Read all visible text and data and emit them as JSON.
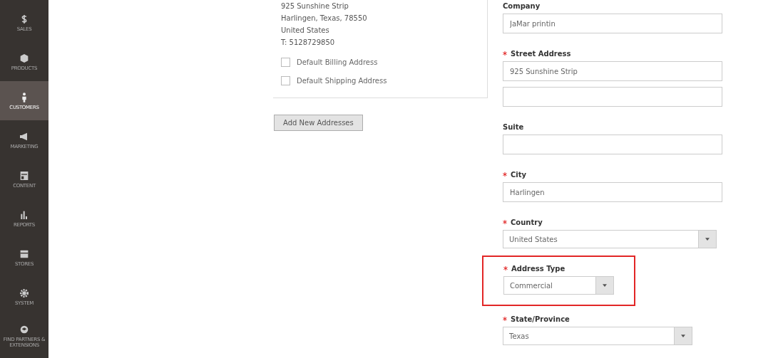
{
  "sidebar": {
    "items": [
      {
        "label": "SALES",
        "selected": false
      },
      {
        "label": "PRODUCTS",
        "selected": false
      },
      {
        "label": "CUSTOMERS",
        "selected": true
      },
      {
        "label": "MARKETING",
        "selected": false
      },
      {
        "label": "CONTENT",
        "selected": false
      },
      {
        "label": "REPORTS",
        "selected": false
      },
      {
        "label": "STORES",
        "selected": false
      },
      {
        "label": "SYSTEM",
        "selected": false
      },
      {
        "label": "FIND PARTNERS & EXTENSIONS",
        "selected": false
      }
    ]
  },
  "address_card": {
    "lines": [
      "925 Sunshine Strip",
      "Harlingen, Texas, 78550",
      "United States",
      "T: 5128729850"
    ],
    "checkboxes": [
      {
        "label": "Default Billing Address",
        "checked": false
      },
      {
        "label": "Default Shipping Address",
        "checked": false
      }
    ]
  },
  "add_button": "Add New Addresses",
  "form": [
    {
      "label": "Company",
      "required": false,
      "highlighted": false,
      "fields": [
        {
          "kind": "input",
          "value": "JaMar printin"
        }
      ]
    },
    {
      "label": "Street Address",
      "required": true,
      "highlighted": false,
      "fields": [
        {
          "kind": "input",
          "value": "925 Sunshine Strip"
        },
        {
          "kind": "input"
        }
      ]
    },
    {
      "label": "Suite",
      "required": false,
      "highlighted": false,
      "fields": [
        {
          "kind": "input"
        }
      ]
    },
    {
      "label": "City",
      "required": true,
      "highlighted": false,
      "fields": [
        {
          "kind": "input",
          "value": "Harlingen"
        }
      ]
    },
    {
      "label": "Country",
      "required": true,
      "highlighted": false,
      "fields": [
        {
          "kind": "select",
          "value": "United States"
        }
      ]
    },
    {
      "label": "Address Type",
      "required": true,
      "highlighted": true,
      "fields": [
        {
          "kind": "select",
          "value": "Commercial"
        }
      ]
    },
    {
      "label": "State/Province",
      "required": true,
      "highlighted": false,
      "fields": [
        {
          "kind": "select",
          "value": "Texas"
        }
      ]
    }
  ]
}
